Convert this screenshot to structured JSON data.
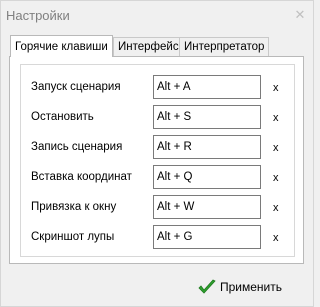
{
  "window": {
    "title": "Настройки"
  },
  "tabs": [
    {
      "label": "Горячие клавиши",
      "active": true
    },
    {
      "label": "Интерфейс",
      "active": false
    },
    {
      "label": "Интерпретатор",
      "active": false
    }
  ],
  "hotkeys": [
    {
      "label": "Запуск сценария",
      "value": "Alt + A",
      "clear": "x"
    },
    {
      "label": "Остановить",
      "value": "Alt + S",
      "clear": "x"
    },
    {
      "label": "Запись сценария",
      "value": "Alt + R",
      "clear": "x"
    },
    {
      "label": "Вставка координат",
      "value": "Alt + Q",
      "clear": "x"
    },
    {
      "label": "Привязка к окну",
      "value": "Alt + W",
      "clear": "x"
    },
    {
      "label": "Скриншот лупы",
      "value": "Alt + G",
      "clear": "x"
    }
  ],
  "footer": {
    "apply_label": "Применить"
  },
  "icons": {
    "close": "close-icon",
    "apply": "checkmark-icon"
  },
  "colors": {
    "check": "#2fa12f"
  }
}
